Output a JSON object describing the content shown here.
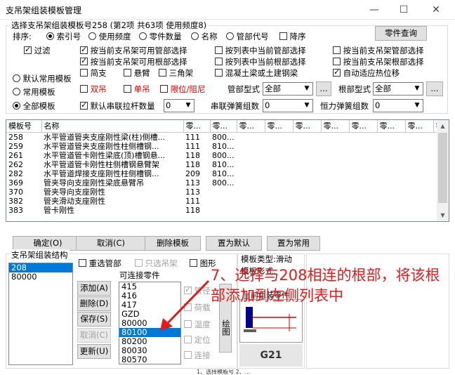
{
  "window": {
    "title": "支吊架组装模板管理",
    "min": "—",
    "max": "☐",
    "close": "✕"
  },
  "group_label": "选择支吊架组装模板号258 (第2项 共63项 使用频度8)",
  "sort": {
    "label": "排序:",
    "options": [
      "索引号",
      "使用频度",
      "零件数量",
      "名称",
      "管部代号"
    ],
    "selected": 0,
    "desc_label": "降序"
  },
  "part_query_button": "零件查询",
  "filter": {
    "label": "过滤",
    "checked": true
  },
  "filters": [
    {
      "label": "按当前支吊架可用管部选择",
      "checked": true
    },
    {
      "label": "按列表中当前管部选择",
      "checked": false
    },
    {
      "label": "按当前支吊架管部选择",
      "checked": false
    },
    {
      "label": "按当前支吊架可用根部选择",
      "checked": true
    },
    {
      "label": "按列表中当前根部选择",
      "checked": false
    },
    {
      "label": "按当前支吊架根部选择",
      "checked": false
    },
    {
      "label": "简支",
      "checked": false
    },
    {
      "label": "悬臂",
      "checked": false
    },
    {
      "label": "三角架",
      "checked": false
    },
    {
      "label": "混凝土梁或土建钢梁",
      "checked": false
    },
    {
      "label": "自动适应热位移",
      "checked": true
    }
  ],
  "template_modes": [
    "默认常用模板",
    "常用模板",
    "全部模板"
  ],
  "template_mode_selected": 2,
  "hanger_types": [
    {
      "label": "双吊"
    },
    {
      "label": "单吊"
    },
    {
      "label": "限位/阻尼"
    }
  ],
  "pipe_type": {
    "label": "管部型式",
    "value": "全部",
    "more": "..."
  },
  "root_type": {
    "label": "根部型式",
    "value": "全部",
    "more": "..."
  },
  "linked_rods": {
    "label": "默认串联拉杆数量",
    "checked": true,
    "value": "0"
  },
  "series_spring": {
    "label": "串联弹簧组数",
    "value": "0"
  },
  "const_spring": {
    "label": "恒力弹簧组数",
    "value": "0"
  },
  "table": {
    "headers": [
      "模板号",
      "名称",
      "零...",
      "零...",
      "零...",
      "零...",
      "零...",
      "零...",
      "零...",
      "零...",
      "零...",
      "零..."
    ],
    "rows": [
      {
        "id": "258",
        "name": "水平管道管夹支座刚性梁(柱)侧槽...",
        "c1": "111",
        "c2": "800..."
      },
      {
        "id": "259",
        "name": "水平管道管夹支座刚性柱侧槽钢...",
        "c1": "111",
        "c2": "810..."
      },
      {
        "id": "261",
        "name": "水平管道管卡刚性梁底(顶)槽钢悬...",
        "c1": "118",
        "c2": "800..."
      },
      {
        "id": "262",
        "name": "水平管道管卡刚性柱侧槽钢悬臂架",
        "c1": "118",
        "c2": "810..."
      },
      {
        "id": "282",
        "name": "水平管道焊接支座刚性柱侧槽钢...",
        "c1": "209",
        "c2": "810..."
      },
      {
        "id": "369",
        "name": "管夹导向支座刚性梁底悬臂吊",
        "c1": "113",
        "c2": "800..."
      },
      {
        "id": "370",
        "name": "管夹导向支座刚性",
        "c1": "113",
        "c2": ""
      },
      {
        "id": "382",
        "name": "管夹滑动支座刚性",
        "c1": "111",
        "c2": ""
      },
      {
        "id": "383",
        "name": "管卡刚性",
        "c1": "118",
        "c2": ""
      }
    ]
  },
  "buttons": {
    "ok": "确定(O)",
    "cancel": "取消(C)",
    "delete_template": "删除模板",
    "set_default": "置为默认",
    "set_common": "置为常用"
  },
  "structure": {
    "title": "支吊架组装结构",
    "items": [
      "208",
      "80000"
    ],
    "selected": 0
  },
  "options": {
    "reselect_pipe": "重选管部",
    "only_select_hanger": "只选吊架",
    "graphic": "图形"
  },
  "connectable": {
    "title": "可连接零件",
    "items": [
      "415",
      "416",
      "417",
      "GZD",
      "80000",
      "80100",
      "80200",
      "80030",
      "80570"
    ],
    "selected": 5
  },
  "side_buttons": {
    "add": "添加(A)",
    "delete": "删除(D)",
    "save": "保存(S)",
    "cancel": "取消(C)",
    "update": "更新(U)"
  },
  "grey_checks": [
    "管径",
    "荷载",
    "温度",
    "定位",
    "连接"
  ],
  "draw_button": "绘图",
  "template_type": "模板类型:滑动",
  "template_form": "模板形式:",
  "current_part": "当前组装零件",
  "g21": "G21",
  "annotation": "7、选择与208相连的根部，将该根部添加到左侧列表中",
  "bottom_strip": "1、选择模板号 2、...",
  "colors": {
    "selection": "#0078d7",
    "annotation": "#e21c1c",
    "red_text": "#e00000"
  }
}
